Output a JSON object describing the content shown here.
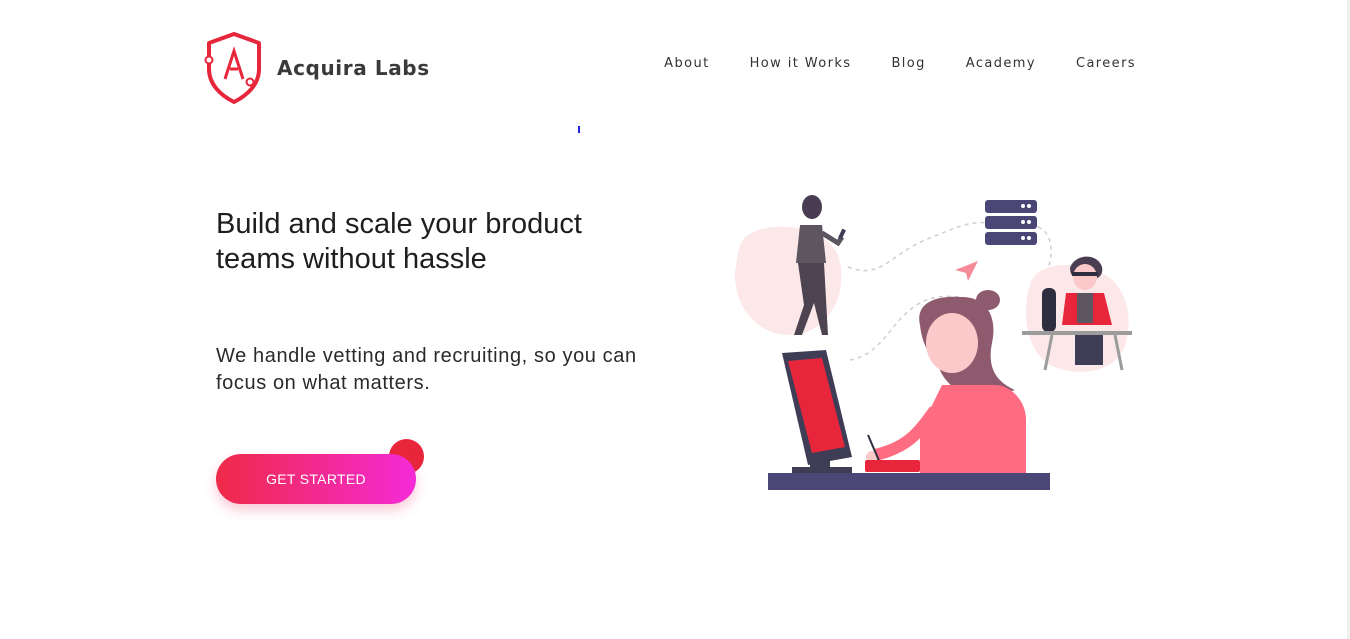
{
  "brand": {
    "name": "Acquira Labs",
    "logo_icon": "shield-a-logo",
    "accent": "#e8263b"
  },
  "nav": {
    "items": [
      {
        "label": "About"
      },
      {
        "label": "How it Works"
      },
      {
        "label": "Blog"
      },
      {
        "label": "Academy"
      },
      {
        "label": "Careers"
      }
    ]
  },
  "hero": {
    "headline": "Build and scale your broduct teams without hassle",
    "subtext": "We handle vetting and recruiting, so you can focus on what matters.",
    "cta_label": "GET STARTED",
    "cta_gradient": [
      "#ef2a47",
      "#f52ad8"
    ],
    "illustration": "team-collaboration-illustration"
  }
}
